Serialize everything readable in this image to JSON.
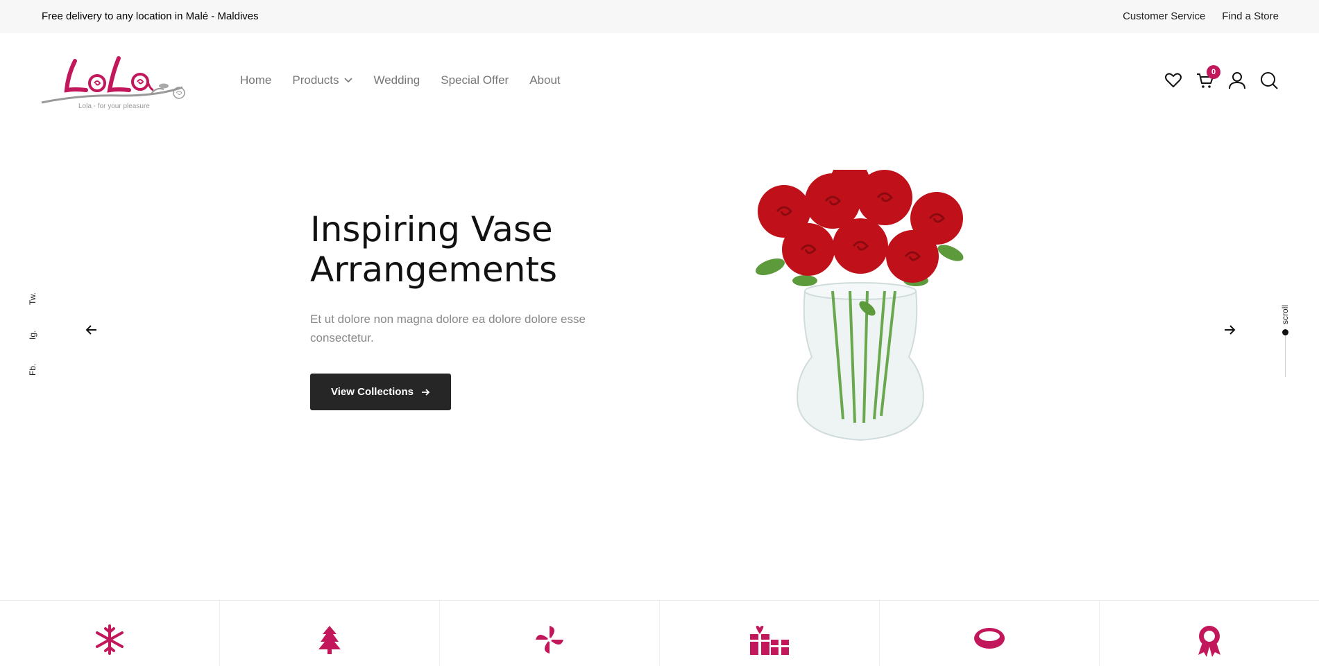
{
  "topbar": {
    "promo": "Free delivery to any location in Malé - Maldives",
    "links": [
      "Customer Service",
      "Find a Store"
    ]
  },
  "logo": {
    "brand": "LoLa",
    "tagline": "Lola - for your pleasure"
  },
  "nav": {
    "items": [
      "Home",
      "Products",
      "Wedding",
      "Special Offer",
      "About"
    ]
  },
  "cart": {
    "count": "0"
  },
  "hero": {
    "title_line1": "Inspiring Vase",
    "title_line2": "Arrangements",
    "text": "Et ut dolore non magna dolore ea dolore dolore esse consectetur.",
    "button_label": "View Collections"
  },
  "social": [
    "Tw.",
    "Ig.",
    "Fb."
  ],
  "scroll_label": "scroll",
  "colors": {
    "accent": "#c2185b",
    "button": "#262626"
  },
  "features": [
    {
      "icon": "snowflake-icon"
    },
    {
      "icon": "christmas-tree-icon"
    },
    {
      "icon": "pinwheel-icon"
    },
    {
      "icon": "gift-icon"
    },
    {
      "icon": "ring-icon"
    },
    {
      "icon": "award-icon"
    }
  ]
}
